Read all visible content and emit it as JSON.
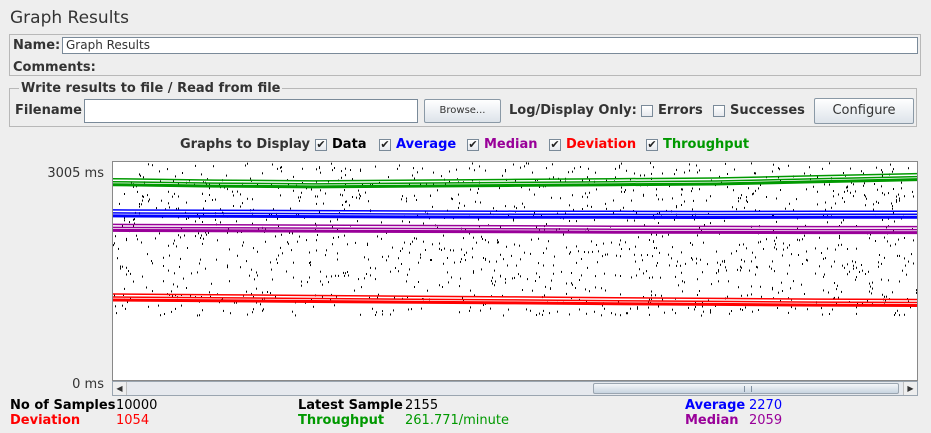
{
  "window": {
    "title": "Graph Results"
  },
  "name_panel": {
    "name_label": "Name:",
    "name_value": "Graph Results",
    "comments_label": "Comments:"
  },
  "file_panel": {
    "legend": "Write results to file / Read from file",
    "filename_label": "Filename",
    "filename_value": "",
    "browse_label": "Browse...",
    "log_display_label": "Log/Display Only:",
    "errors_label": "Errors",
    "errors_checked": false,
    "successes_label": "Successes",
    "successes_checked": false,
    "configure_label": "Configure"
  },
  "graphs_to_display": {
    "label": "Graphs to Display",
    "items": [
      {
        "label": "Data",
        "checked": true,
        "color": "#000000"
      },
      {
        "label": "Average",
        "checked": true,
        "color": "#0000ff"
      },
      {
        "label": "Median",
        "checked": true,
        "color": "#990099"
      },
      {
        "label": "Deviation",
        "checked": true,
        "color": "#ff0000"
      },
      {
        "label": "Throughput",
        "checked": true,
        "color": "#009900"
      }
    ]
  },
  "y_axis": {
    "max_label": "3005 ms",
    "min_label": "0 ms"
  },
  "chart_data": {
    "type": "line",
    "ylim": [
      0,
      3005
    ],
    "series": [
      {
        "name": "Throughput",
        "color": "#009900",
        "values": [
          2720,
          2700,
          2690,
          2700,
          2710,
          2720,
          2730,
          2760,
          2790
        ]
      },
      {
        "name": "Average",
        "color": "#0000ff",
        "values": [
          2290,
          2285,
          2280,
          2275,
          2272,
          2270,
          2268,
          2270,
          2270
        ]
      },
      {
        "name": "Median",
        "color": "#990099",
        "values": [
          2090,
          2085,
          2080,
          2075,
          2070,
          2065,
          2062,
          2060,
          2059
        ]
      },
      {
        "name": "Deviation",
        "color": "#ff0000",
        "values": [
          1130,
          1120,
          1110,
          1100,
          1090,
          1080,
          1070,
          1060,
          1054
        ]
      }
    ],
    "data_scatter": {
      "color": "#000000",
      "range": [
        900,
        3005
      ]
    }
  },
  "stats": {
    "samples_label": "No of Samples",
    "samples_value": "10000",
    "latest_label": "Latest Sample",
    "latest_value": "2155",
    "average_label": "Average",
    "average_value": "2270",
    "deviation_label": "Deviation",
    "deviation_value": "1054",
    "throughput_label": "Throughput",
    "throughput_value": "261.771/minute",
    "median_label": "Median",
    "median_value": "2059"
  },
  "colors": {
    "data": "#000000",
    "average": "#0000ff",
    "median": "#990099",
    "deviation": "#ff0000",
    "throughput": "#009900"
  }
}
